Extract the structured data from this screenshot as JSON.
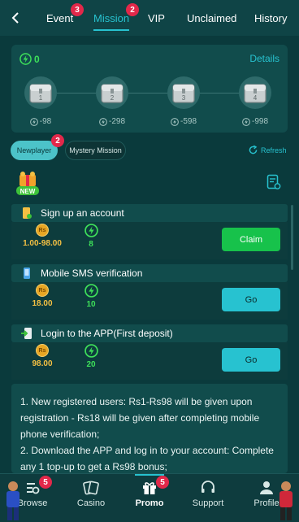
{
  "topnav": {
    "back": "chevron-left",
    "tabs": [
      {
        "label": "Event",
        "badge": "3",
        "active": false
      },
      {
        "label": "Mission",
        "badge": "2",
        "active": true
      },
      {
        "label": "VIP",
        "active": false
      },
      {
        "label": "Unclaimed",
        "active": false
      },
      {
        "label": "History",
        "active": false
      }
    ]
  },
  "progress": {
    "coins": "0",
    "details_label": "Details",
    "chests": [
      {
        "label": "1",
        "reward": "-98"
      },
      {
        "label": "2",
        "reward": "-298"
      },
      {
        "label": "3",
        "reward": "-598"
      },
      {
        "label": "4",
        "reward": "-998"
      }
    ]
  },
  "filters": {
    "newplayer_label": "Newplayer",
    "newplayer_badge": "2",
    "mystery_label": "Mystery Mission",
    "refresh_label": "Refresh"
  },
  "tasks": [
    {
      "title": "Sign up an account",
      "cash": "1.00-98.00",
      "points": "8",
      "button": "Claim"
    },
    {
      "title": "Mobile SMS verification",
      "cash": "18.00",
      "points": "10",
      "button": "Go"
    },
    {
      "title": "Login to the APP(First deposit)",
      "cash": "98.00",
      "points": "20",
      "button": "Go"
    }
  ],
  "rs_symbol": "Rs",
  "description": {
    "line1": "1. New registered users: Rs1-Rs98 will be given upon registration - Rs18 will be given after completing mobile phone verification;",
    "line2": "2. Download the APP and log in to your account: Complete any 1 top-up to get a Rs98 bonus;"
  },
  "bottomnav": {
    "items": [
      {
        "label": "Browse",
        "badge": "5"
      },
      {
        "label": "Casino"
      },
      {
        "label": "Promo",
        "badge": "5",
        "active": true
      },
      {
        "label": "Support"
      },
      {
        "label": "Profile"
      }
    ]
  },
  "colors": {
    "accent": "#27c2cf",
    "claim": "#17c24b",
    "points": "#3ee05a",
    "cash": "#f4c043",
    "badge": "#e2284a"
  }
}
